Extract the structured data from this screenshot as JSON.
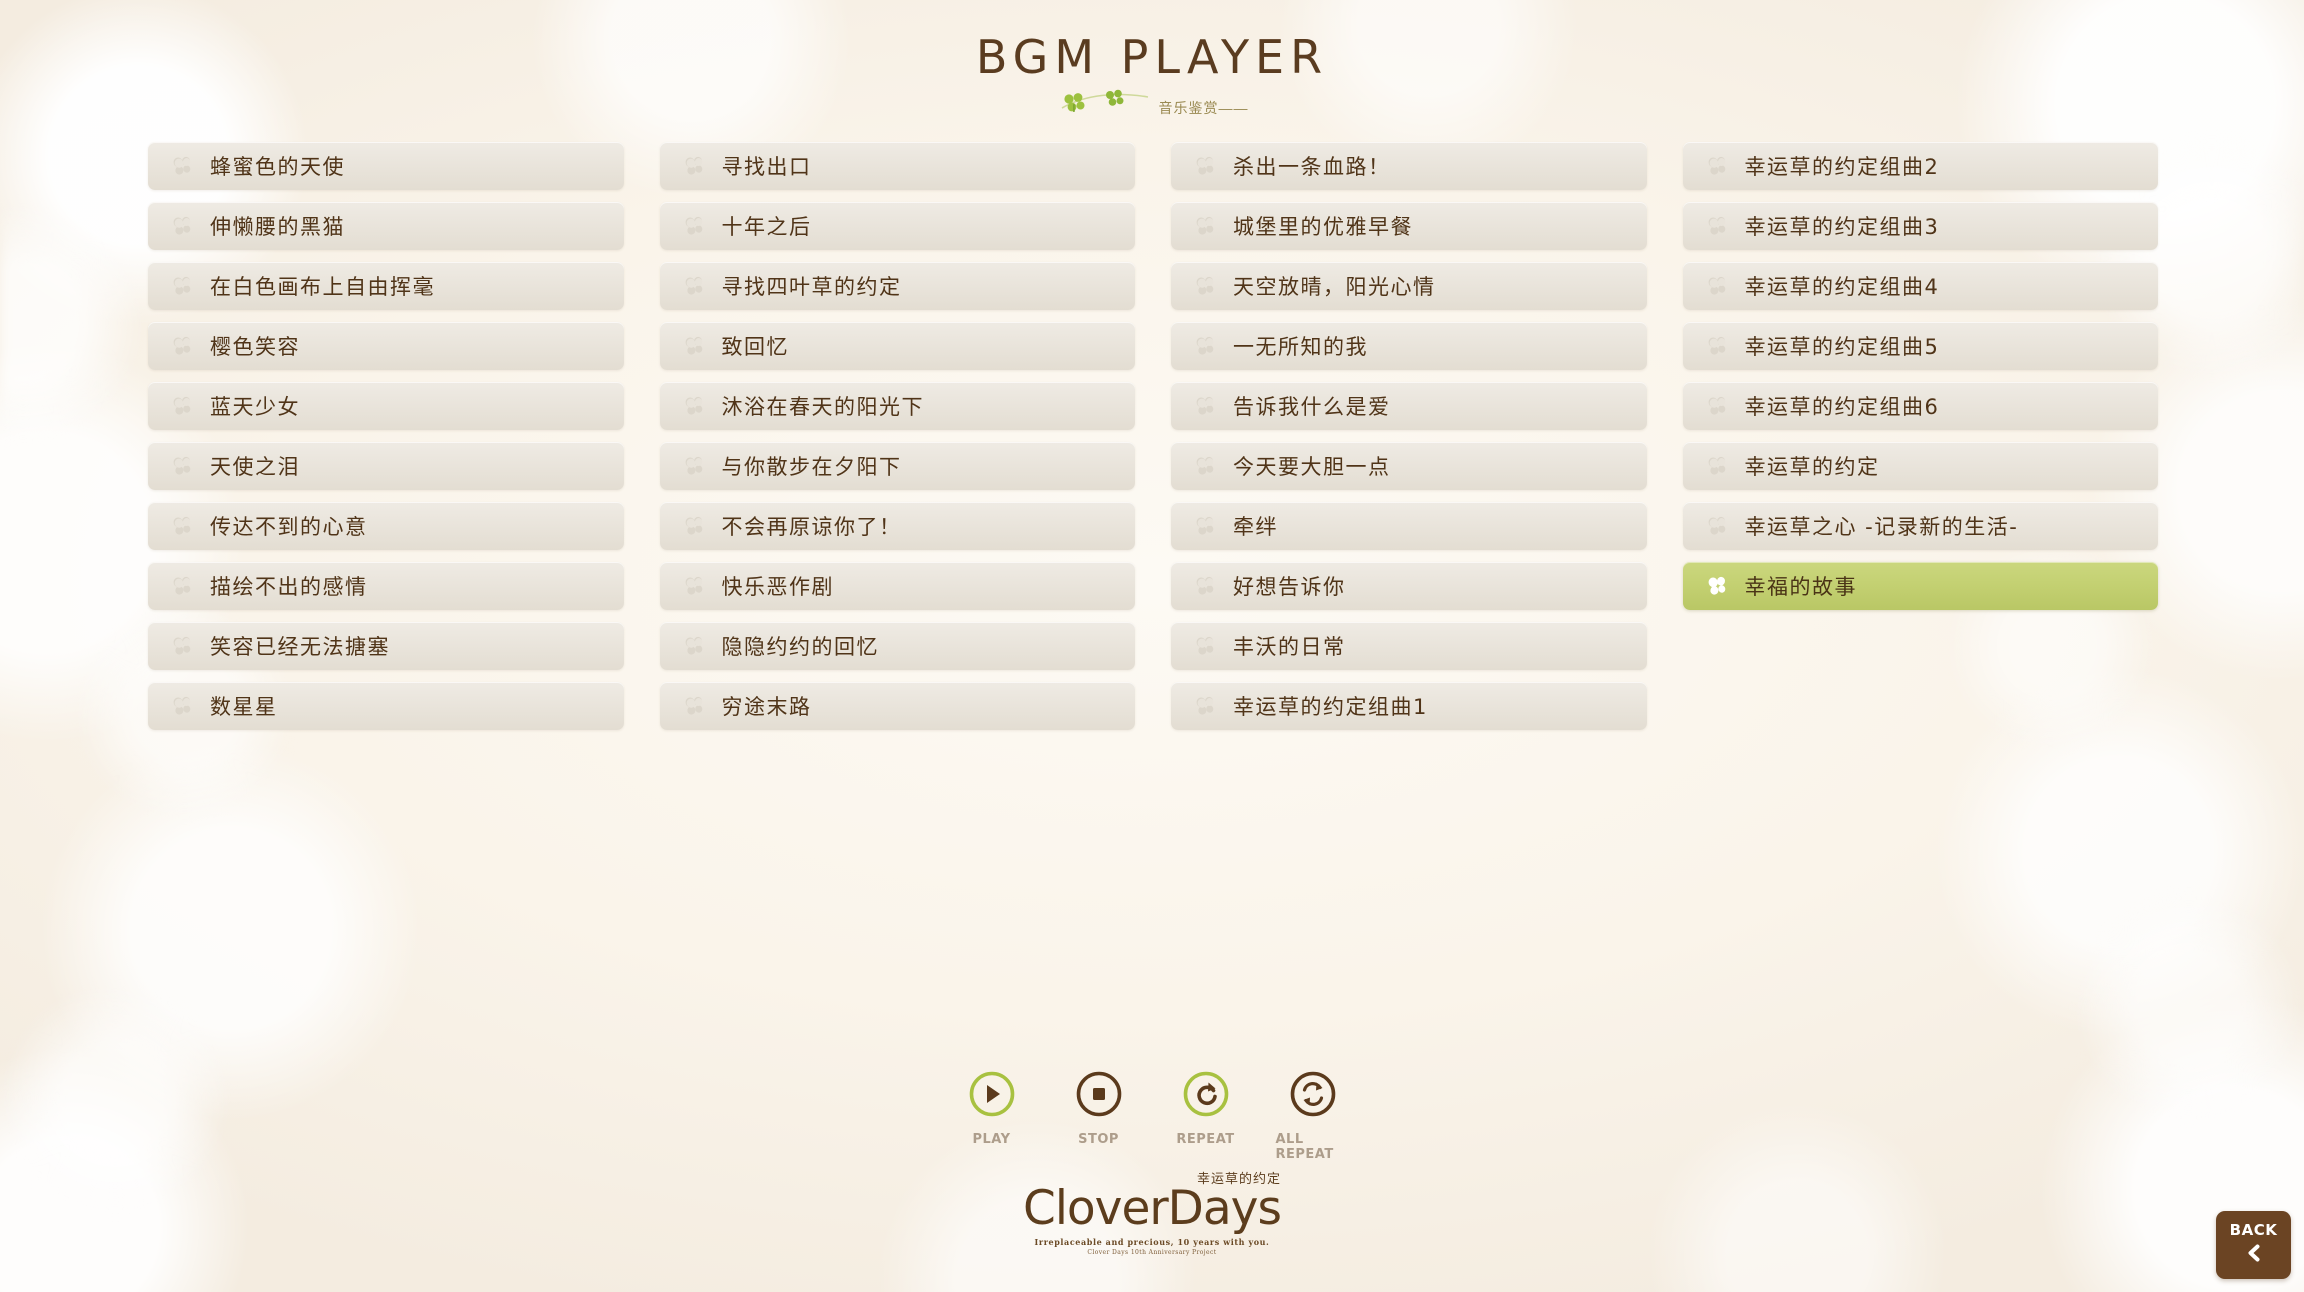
{
  "header": {
    "title": "BGM PLAYER",
    "subtitle": "音乐鉴赏——"
  },
  "colors": {
    "selected_bg": "#c3d071",
    "text_brown": "#503418",
    "accent_green": "#a8c140",
    "dark_brown": "#6b4423",
    "button_bg": "#e9e4db"
  },
  "song_columns": [
    {
      "songs": [
        {
          "title": "蜂蜜色的天使",
          "selected": false
        },
        {
          "title": "伸懒腰的黑猫",
          "selected": false
        },
        {
          "title": "在白色画布上自由挥毫",
          "selected": false
        },
        {
          "title": "樱色笑容",
          "selected": false
        },
        {
          "title": "蓝天少女",
          "selected": false
        },
        {
          "title": "天使之泪",
          "selected": false
        },
        {
          "title": "传达不到的心意",
          "selected": false
        },
        {
          "title": "描绘不出的感情",
          "selected": false
        },
        {
          "title": "笑容已经无法搪塞",
          "selected": false
        },
        {
          "title": "数星星",
          "selected": false
        }
      ]
    },
    {
      "songs": [
        {
          "title": "寻找出口",
          "selected": false
        },
        {
          "title": "十年之后",
          "selected": false
        },
        {
          "title": "寻找四叶草的约定",
          "selected": false
        },
        {
          "title": "致回忆",
          "selected": false
        },
        {
          "title": "沐浴在春天的阳光下",
          "selected": false
        },
        {
          "title": "与你散步在夕阳下",
          "selected": false
        },
        {
          "title": "不会再原谅你了！",
          "selected": false
        },
        {
          "title": "快乐恶作剧",
          "selected": false
        },
        {
          "title": "隐隐约约的回忆",
          "selected": false
        },
        {
          "title": "穷途末路",
          "selected": false
        }
      ]
    },
    {
      "songs": [
        {
          "title": "杀出一条血路！",
          "selected": false
        },
        {
          "title": "城堡里的优雅早餐",
          "selected": false
        },
        {
          "title": "天空放晴，阳光心情",
          "selected": false
        },
        {
          "title": "一无所知的我",
          "selected": false
        },
        {
          "title": "告诉我什么是爱",
          "selected": false
        },
        {
          "title": "今天要大胆一点",
          "selected": false
        },
        {
          "title": "牵绊",
          "selected": false
        },
        {
          "title": "好想告诉你",
          "selected": false
        },
        {
          "title": "丰沃的日常",
          "selected": false
        },
        {
          "title": "幸运草的约定组曲1",
          "selected": false
        }
      ]
    },
    {
      "songs": [
        {
          "title": "幸运草的约定组曲2",
          "selected": false
        },
        {
          "title": "幸运草的约定组曲3",
          "selected": false
        },
        {
          "title": "幸运草的约定组曲4",
          "selected": false
        },
        {
          "title": "幸运草的约定组曲5",
          "selected": false
        },
        {
          "title": "幸运草的约定组曲6",
          "selected": false
        },
        {
          "title": "幸运草的约定",
          "selected": false
        },
        {
          "title": "幸运草之心 -记录新的生活-",
          "selected": false
        },
        {
          "title": "幸福的故事",
          "selected": true
        }
      ]
    }
  ],
  "controls": [
    {
      "label": "PLAY",
      "icon": "play-icon",
      "active": true
    },
    {
      "label": "STOP",
      "icon": "stop-icon",
      "active": false
    },
    {
      "label": "REPEAT",
      "icon": "repeat-icon",
      "active": true
    },
    {
      "label": "ALL REPEAT",
      "icon": "all-repeat-icon",
      "active": false
    }
  ],
  "footer": {
    "logo_main": "CloverDays",
    "logo_cn": "幸运草的约定",
    "tagline1": "Irreplaceable and precious, 10 years with you.",
    "tagline2": "Clover Days 10th Anniversary Project"
  },
  "back": {
    "label": "BACK",
    "icon": "chevron-left-icon"
  }
}
